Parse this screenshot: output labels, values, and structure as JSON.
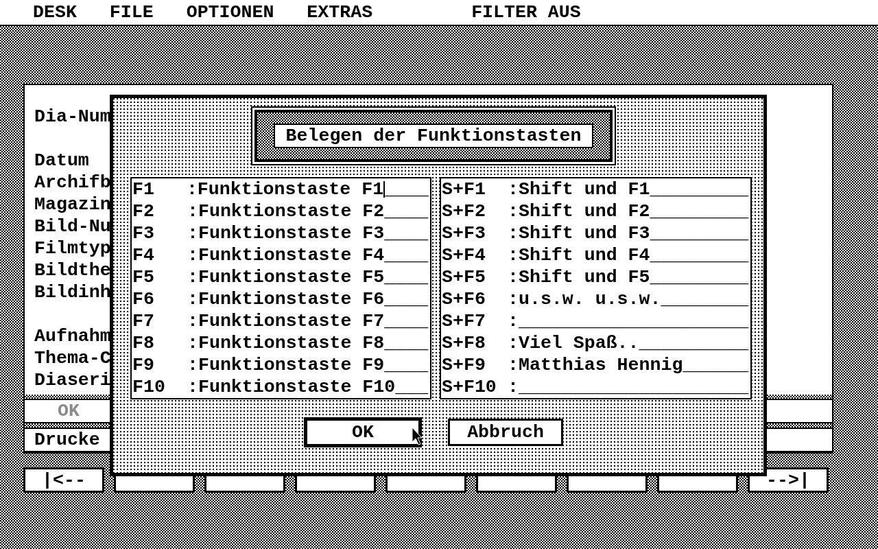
{
  "menu_bar": {
    "items": [
      "DESK",
      "FILE",
      "OPTIONEN",
      "EXTRAS"
    ],
    "status": "FILTER AUS"
  },
  "record_window": {
    "field_groups": [
      [
        "Dia-Num"
      ],
      [
        "Datum",
        "Archifb",
        "Magazin",
        "Bild-Nu",
        "Filmtyp",
        "Bildthe",
        "Bildinh"
      ],
      [
        "Aufnahm",
        "Thema-C",
        "Diaseri"
      ]
    ],
    "buttons": [
      {
        "label": "OK",
        "disabled": true
      },
      {
        "label": "Drucke",
        "disabled": false
      }
    ]
  },
  "nav_buttons": [
    {
      "kind": "text",
      "label": "|<--"
    },
    {
      "kind": "covered"
    },
    {
      "kind": "covered"
    },
    {
      "kind": "covered"
    },
    {
      "kind": "covered"
    },
    {
      "kind": "covered"
    },
    {
      "kind": "covered"
    },
    {
      "kind": "covered"
    },
    {
      "kind": "text",
      "label": "-->|"
    }
  ],
  "dialog": {
    "title": "Belegen der Funktionstasten",
    "left_keys": [
      {
        "key": "F1",
        "text": ":Funktionstaste F1",
        "fill": "____",
        "focused": true
      },
      {
        "key": "F2",
        "text": ":Funktionstaste F2",
        "fill": "____",
        "focused": false
      },
      {
        "key": "F3",
        "text": ":Funktionstaste F3",
        "fill": "____",
        "focused": false
      },
      {
        "key": "F4",
        "text": ":Funktionstaste F4",
        "fill": "____",
        "focused": false
      },
      {
        "key": "F5",
        "text": ":Funktionstaste F5",
        "fill": "____",
        "focused": false
      },
      {
        "key": "F6",
        "text": ":Funktionstaste F6",
        "fill": "____",
        "focused": false
      },
      {
        "key": "F7",
        "text": ":Funktionstaste F7",
        "fill": "____",
        "focused": false
      },
      {
        "key": "F8",
        "text": ":Funktionstaste F8",
        "fill": "____",
        "focused": false
      },
      {
        "key": "F9",
        "text": ":Funktionstaste F9",
        "fill": "____",
        "focused": false
      },
      {
        "key": "F10",
        "text": ":Funktionstaste F10",
        "fill": "___",
        "focused": false
      }
    ],
    "right_keys": [
      {
        "key": "S+F1",
        "text": ":Shift und F1",
        "fill": "_________",
        "focused": false
      },
      {
        "key": "S+F2",
        "text": ":Shift und F2",
        "fill": "_________",
        "focused": false
      },
      {
        "key": "S+F3",
        "text": ":Shift und F3",
        "fill": "_________",
        "focused": false
      },
      {
        "key": "S+F4",
        "text": ":Shift und F4",
        "fill": "_________",
        "focused": false
      },
      {
        "key": "S+F5",
        "text": ":Shift und F5",
        "fill": "_________",
        "focused": false
      },
      {
        "key": "S+F6",
        "text": ":u.s.w. u.s.w.",
        "fill": "________",
        "focused": false
      },
      {
        "key": "S+F7",
        "text": ":",
        "fill": "_____________________",
        "focused": false
      },
      {
        "key": "S+F8",
        "text": ":Viel Spaß..",
        "fill": "__________",
        "focused": false
      },
      {
        "key": "S+F9",
        "text": ":Matthias Hennig",
        "fill": "______",
        "focused": false
      },
      {
        "key": "S+F10",
        "text": ":",
        "fill": "_____________________",
        "focused": false
      }
    ],
    "buttons": [
      {
        "label": "OK",
        "default": true
      },
      {
        "label": "Abbruch",
        "default": false
      }
    ]
  }
}
